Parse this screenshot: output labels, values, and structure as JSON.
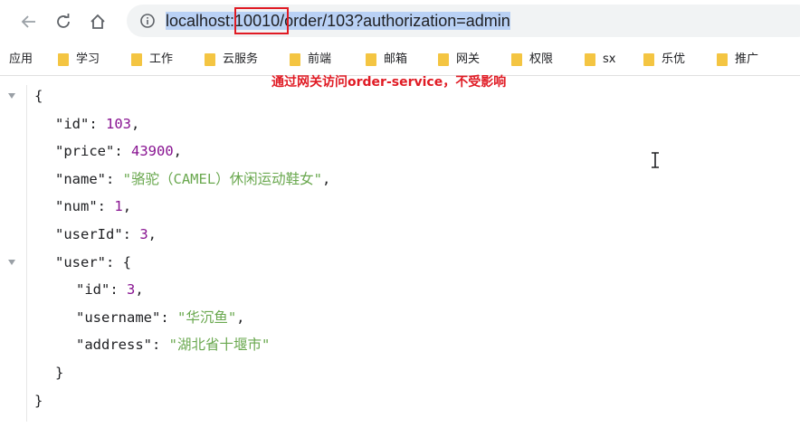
{
  "toolbar": {
    "back_icon": "arrow-left-icon",
    "reload_icon": "reload-icon",
    "home_icon": "home-icon",
    "info_icon": "info-icon",
    "url_host": "localhost:",
    "url_port": "10010",
    "url_path": "/order/103?authorization=admin"
  },
  "bookmarks": {
    "apps_label": "应用",
    "items": [
      "学习",
      "工作",
      "云服务",
      "前端",
      "邮箱",
      "网关",
      "权限",
      "sx",
      "乐优",
      "推广"
    ],
    "folder_color": "#f4c542"
  },
  "annotation": "通过网关访问order-service，不受影响",
  "json_view": {
    "lines": [
      {
        "indent": 0,
        "open": "{"
      },
      {
        "indent": 1,
        "key": "\"id\"",
        "value": "103",
        "type": "number"
      },
      {
        "indent": 1,
        "key": "\"price\"",
        "value": "43900",
        "type": "number"
      },
      {
        "indent": 1,
        "key": "\"name\"",
        "value": "\"骆驼（CAMEL）休闲运动鞋女\"",
        "type": "string"
      },
      {
        "indent": 1,
        "key": "\"num\"",
        "value": "1",
        "type": "number"
      },
      {
        "indent": 1,
        "key": "\"userId\"",
        "value": "3",
        "type": "number"
      },
      {
        "indent": 1,
        "key": "\"user\"",
        "value": "{",
        "type": "object"
      },
      {
        "indent": 2,
        "key": "\"id\"",
        "value": "3",
        "type": "number"
      },
      {
        "indent": 2,
        "key": "\"username\"",
        "value": "\"华沉鱼\"",
        "type": "string"
      },
      {
        "indent": 2,
        "key": "\"address\"",
        "value": "\"湖北省十堰市\"",
        "type": "string",
        "last": true
      },
      {
        "indent": 1,
        "close": "}"
      },
      {
        "indent": 0,
        "close": "}"
      }
    ]
  },
  "colors": {
    "number": "#881391",
    "string": "#6aa84f",
    "annotation": "#e01b24",
    "highlight": "#b9d1f5"
  }
}
